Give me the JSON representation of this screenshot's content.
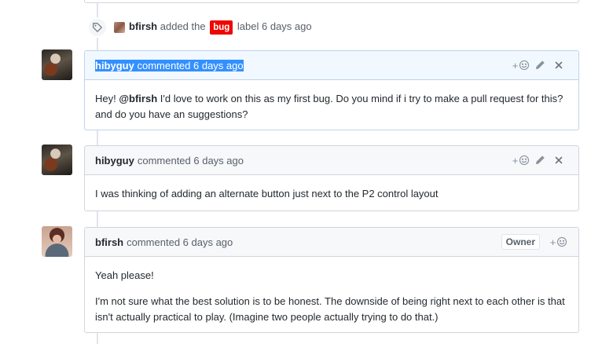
{
  "event": {
    "actor": "bfirsh",
    "action_before": "added the",
    "label": "bug",
    "action_after": "label 6 days ago",
    "label_color": "#ee0701"
  },
  "comments": [
    {
      "author": "hibyguy",
      "meta": "commented 6 days ago",
      "header_style": "blue",
      "highlighted": true,
      "body_prefix": "Hey! ",
      "mention": "@bfirsh",
      "body_rest": " I'd love to work on this as my first bug. Do you mind if i try to make a pull request for this? and do you have an suggestions?"
    },
    {
      "author": "hibyguy",
      "meta": "commented 6 days ago",
      "header_style": "gray",
      "body": "I was thinking of adding an alternate button just next to the P2 control layout"
    },
    {
      "author": "bfirsh",
      "meta": "commented 6 days ago",
      "badge": "Owner",
      "header_style": "gray",
      "paragraphs": [
        "Yeah please!",
        "I'm not sure what the best solution is to be honest. The downside of being right next to each other is that isn't actually practical to play. (Imagine two people actually trying to do that.)"
      ]
    }
  ],
  "icons": {
    "event": "tag-icon",
    "reaction": "smiley-icon",
    "edit": "pencil-icon",
    "delete": "x-icon"
  },
  "reaction_plus": "+"
}
